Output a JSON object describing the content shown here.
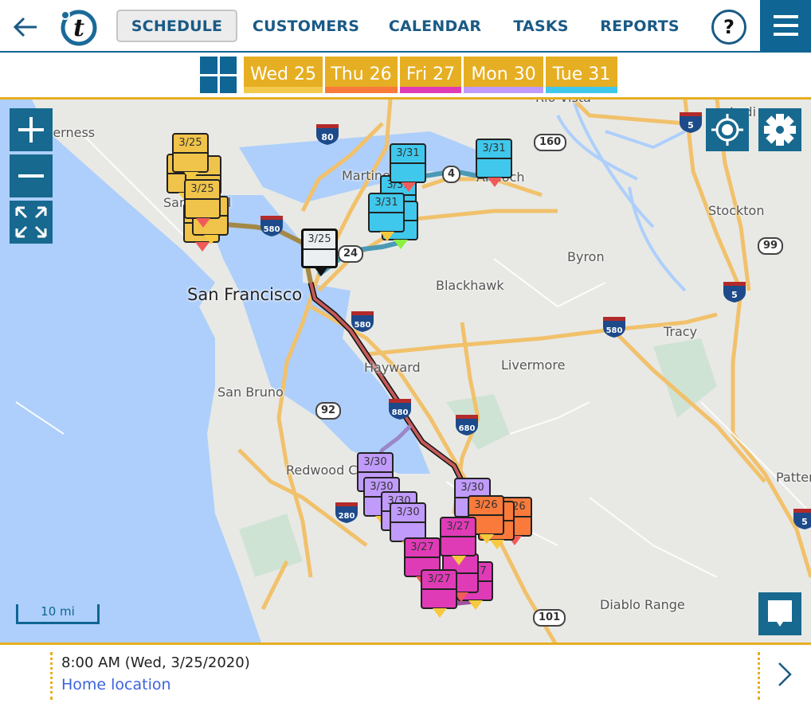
{
  "header": {
    "back_icon": "arrow-left-icon",
    "logo_icon": "t-logo-icon",
    "nav": [
      {
        "label": "SCHEDULE",
        "active": true
      },
      {
        "label": "CUSTOMERS",
        "active": false
      },
      {
        "label": "CALENDAR",
        "active": false
      },
      {
        "label": "TASKS",
        "active": false
      },
      {
        "label": "REPORTS",
        "active": false
      }
    ],
    "help_label": "?",
    "menu_icon": "hamburger-icon"
  },
  "days": [
    {
      "label": "Wed 25",
      "color": "#f2c94c"
    },
    {
      "label": "Thu 26",
      "color": "#f97a3a"
    },
    {
      "label": "Fri 27",
      "color": "#e03bb7"
    },
    {
      "label": "Mon 30",
      "color": "#c09bfb"
    },
    {
      "label": "Tue 31",
      "color": "#3fc8ec"
    }
  ],
  "map": {
    "controls": {
      "zoom_in": "plus-icon",
      "zoom_out": "minus-icon",
      "fit": "expand-icon",
      "locate": "crosshair-icon",
      "settings": "gear-icon",
      "callout": "speech-bubble-icon"
    },
    "places": {
      "inverness": "Inverness",
      "san_rafael": "San Rafael",
      "martinez": "Martinez",
      "antioch": "Antioch",
      "rio_vista": "Rio Vista",
      "lodi": "Lodi",
      "stockton": "Stockton",
      "byron": "Byron",
      "blackhawk": "Blackhawk",
      "san_francisco": "San Francisco",
      "tracy": "Tracy",
      "livermore": "Livermore",
      "hayward": "Hayward",
      "san_bruno": "San Bruno",
      "redwood_city": "Redwood City",
      "patterson": "Patterson",
      "diablo_range": "Diablo Range"
    },
    "shields": {
      "i80": "80",
      "i580a": "580",
      "i580b": "580",
      "i580c": "580",
      "i5a": "5",
      "i5b": "5",
      "i5c": "5",
      "i880": "880",
      "i680": "680",
      "i280": "280",
      "r160": "160",
      "r99": "99",
      "r4": "4",
      "r24": "24",
      "r92": "92",
      "us101": "101"
    },
    "pins": {
      "p25a": "3/25",
      "p25b": "3/25",
      "p25w": "3/25",
      "p31a": "3/31",
      "p31b": "3/31",
      "p31c": "3/31",
      "p31d": "3/31",
      "p30a": "3/30",
      "p30b": "3/30",
      "p30c": "3/30",
      "p30d": "3/30",
      "p30e": "3/30",
      "p26a": "3/26",
      "p26b": "3/26",
      "p27a": "3/27",
      "p27b": "3/27",
      "p27c": "3/27",
      "p27d": "3/27"
    },
    "scale_label": "10 mi"
  },
  "footer": {
    "time": "8:00 AM (Wed, 3/25/2020)",
    "location": "Home location",
    "next_icon": "chevron-right-icon"
  }
}
